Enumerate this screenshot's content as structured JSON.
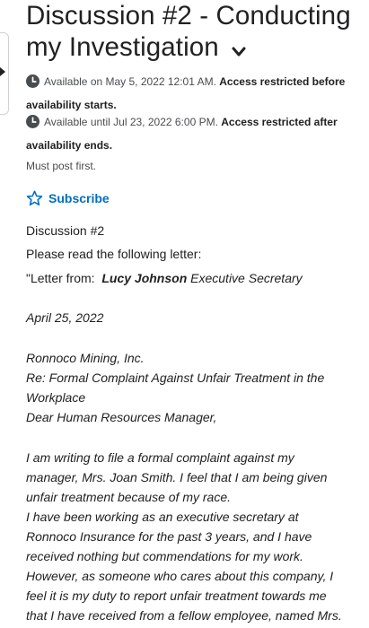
{
  "page": {
    "title": "Discussion #2 - Conducting my Investigation"
  },
  "availability": {
    "start_line1_plain": "Available on May 5, 2022 12:01 AM.",
    "start_line1_bold": "Access restricted before",
    "start_line2_bold": "availability starts.",
    "end_line1_plain": "Available until Jul 23, 2022 6:00 PM.",
    "end_line1_bold": "Access restricted after",
    "end_line2_bold": "availability ends.",
    "must_post": "Must post first."
  },
  "subscribe_label": "Subscribe",
  "content": {
    "heading": "Discussion #2",
    "intro": "Please read the following letter:",
    "letter_from_prefix": "\"Letter from:",
    "letter_from_name": "Lucy Johnson",
    "letter_from_title": "Executive Secretary",
    "date": "April 25, 2022",
    "company": "Ronnoco Mining, Inc.",
    "re_line1": "Re: Formal Complaint Against Unfair Treatment in the",
    "re_line2": "Workplace",
    "salutation": "Dear Human Resources Manager,",
    "para_lines": [
      "I am writing to file a formal complaint against my",
      "manager, Mrs. Joan Smith. I feel that I am being given",
      "unfair treatment because of my race.",
      "I have been working as an executive secretary at",
      "Ronnoco Insurance for the past 3 years, and I have",
      "received nothing but commendations for my work.",
      "However, as someone who cares about this company, I",
      "feel it is my duty to report unfair treatment towards me",
      "that I have received from a fellow employee, named Mrs."
    ]
  },
  "icons": {
    "side_tab": "expand-arrow-icon",
    "title": "chevron-down-icon",
    "availability": "clock-icon",
    "subscribe": "star-outline-icon"
  },
  "colors": {
    "link": "#006fbf",
    "text": "#202122",
    "muted": "#494c4e"
  }
}
